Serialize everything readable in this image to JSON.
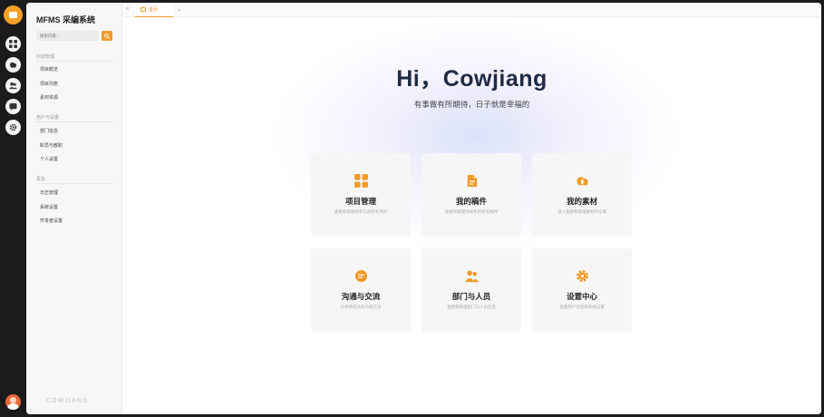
{
  "app": {
    "title": "MFMS 采编系统",
    "footer_brand": "COWJIANG",
    "accent_color": "#f19b28"
  },
  "rail": {
    "items": [
      {
        "icon": "app-grid-icon"
      },
      {
        "icon": "cloud-icon"
      },
      {
        "icon": "users-icon"
      },
      {
        "icon": "chat-icon"
      },
      {
        "icon": "gear-icon"
      }
    ]
  },
  "sidebar": {
    "search_placeholder": "搜索内容...",
    "groups": [
      {
        "label": "内容管理",
        "items": [
          "项目概览",
          "项目列表",
          "素材资源"
        ]
      },
      {
        "label": "用户与设置",
        "items": [
          "部门信息",
          "职员与教职",
          "个人设置"
        ]
      },
      {
        "label": "更多",
        "items": [
          "日志管理",
          "系统设置",
          "开发者设置"
        ]
      }
    ]
  },
  "tabs": {
    "active": "首页"
  },
  "hero": {
    "title": "Hi，Cowjiang",
    "subtitle": "有事做有所期待，日子就是幸福的"
  },
  "cards": [
    {
      "title": "项目管理",
      "desc": "查看和管理你参与的所有项目",
      "icon": "apps-icon"
    },
    {
      "title": "我的稿件",
      "desc": "查看和管理你发布的所有稿件",
      "icon": "document-icon"
    },
    {
      "title": "我的素材",
      "desc": "进入查看和管理素材的仓库",
      "icon": "cloud-upload-icon"
    },
    {
      "title": "沟通与交流",
      "desc": "与项目成员的沟通交流",
      "icon": "chat-bubble-icon"
    },
    {
      "title": "部门与人员",
      "desc": "查看和管理部门与人员信息",
      "icon": "people-icon"
    },
    {
      "title": "设置中心",
      "desc": "查看用户信息和系统设置",
      "icon": "settings-icon"
    }
  ]
}
